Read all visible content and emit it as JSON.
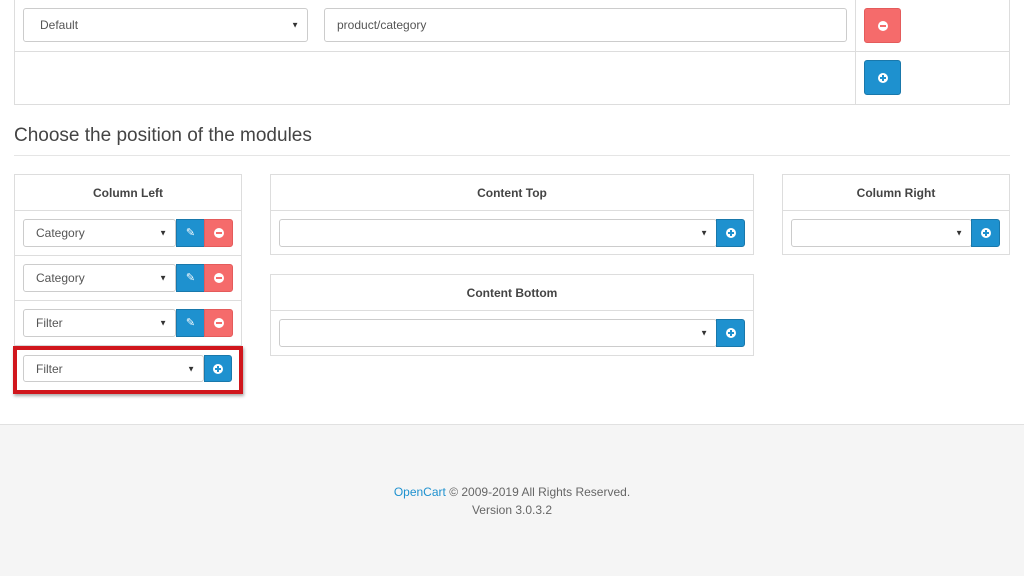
{
  "route": {
    "store_select": "Default",
    "route_value": "product/category"
  },
  "heading": "Choose the position of the modules",
  "panels": {
    "column_left": {
      "title": "Column Left",
      "rows": [
        {
          "module": "Category"
        },
        {
          "module": "Category"
        },
        {
          "module": "Filter"
        }
      ],
      "add_select": "Filter"
    },
    "content_top": {
      "title": "Content Top",
      "add_select": ""
    },
    "content_bottom": {
      "title": "Content Bottom",
      "add_select": ""
    },
    "column_right": {
      "title": "Column Right",
      "add_select": ""
    }
  },
  "footer": {
    "brand": "OpenCart",
    "copyright": "© 2009-2019 All Rights Reserved.",
    "version": "Version 3.0.3.2"
  },
  "colors": {
    "accent_blue": "#1e91cf",
    "danger_red": "#f56b6b",
    "highlight_red": "#d0161c"
  },
  "icons": [
    "minus-circle-icon",
    "plus-circle-icon",
    "pencil-icon",
    "caret-down-icon"
  ]
}
